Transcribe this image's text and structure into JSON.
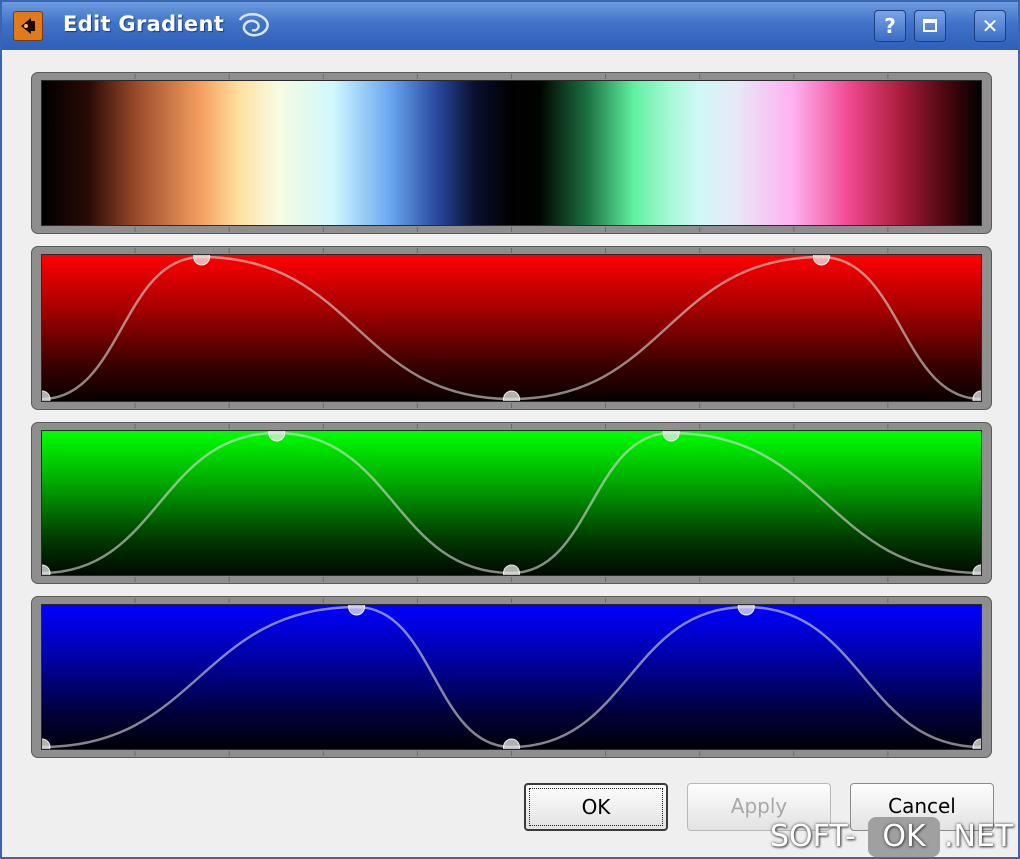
{
  "window": {
    "title": "Edit Gradient",
    "app_icon": "app-logo-icon",
    "title_swirl_icon": "swirl-icon",
    "help_button_label": "?",
    "close_button_label": "✕"
  },
  "editors": [
    {
      "channel": "preview",
      "color": "#ffffff"
    },
    {
      "channel": "red",
      "color": "#ff0000",
      "control_points": [
        [
          0.0,
          0.0
        ],
        [
          0.17,
          1.0
        ],
        [
          0.5,
          0.0
        ],
        [
          0.83,
          1.0
        ],
        [
          1.0,
          0.0
        ]
      ]
    },
    {
      "channel": "green",
      "color": "#00ff00",
      "control_points": [
        [
          0.0,
          0.0
        ],
        [
          0.25,
          1.0
        ],
        [
          0.5,
          0.0
        ],
        [
          0.67,
          1.0
        ],
        [
          1.0,
          0.0
        ]
      ]
    },
    {
      "channel": "blue",
      "color": "#0000ff",
      "control_points": [
        [
          0.0,
          0.0
        ],
        [
          0.335,
          1.0
        ],
        [
          0.5,
          0.0
        ],
        [
          0.75,
          1.0
        ],
        [
          1.0,
          0.0
        ]
      ]
    }
  ],
  "buttons": {
    "ok": "OK",
    "apply": "Apply",
    "cancel": "Cancel"
  },
  "watermark": {
    "left": "SOFT-",
    "middle": "OK",
    "right": ".NET"
  }
}
